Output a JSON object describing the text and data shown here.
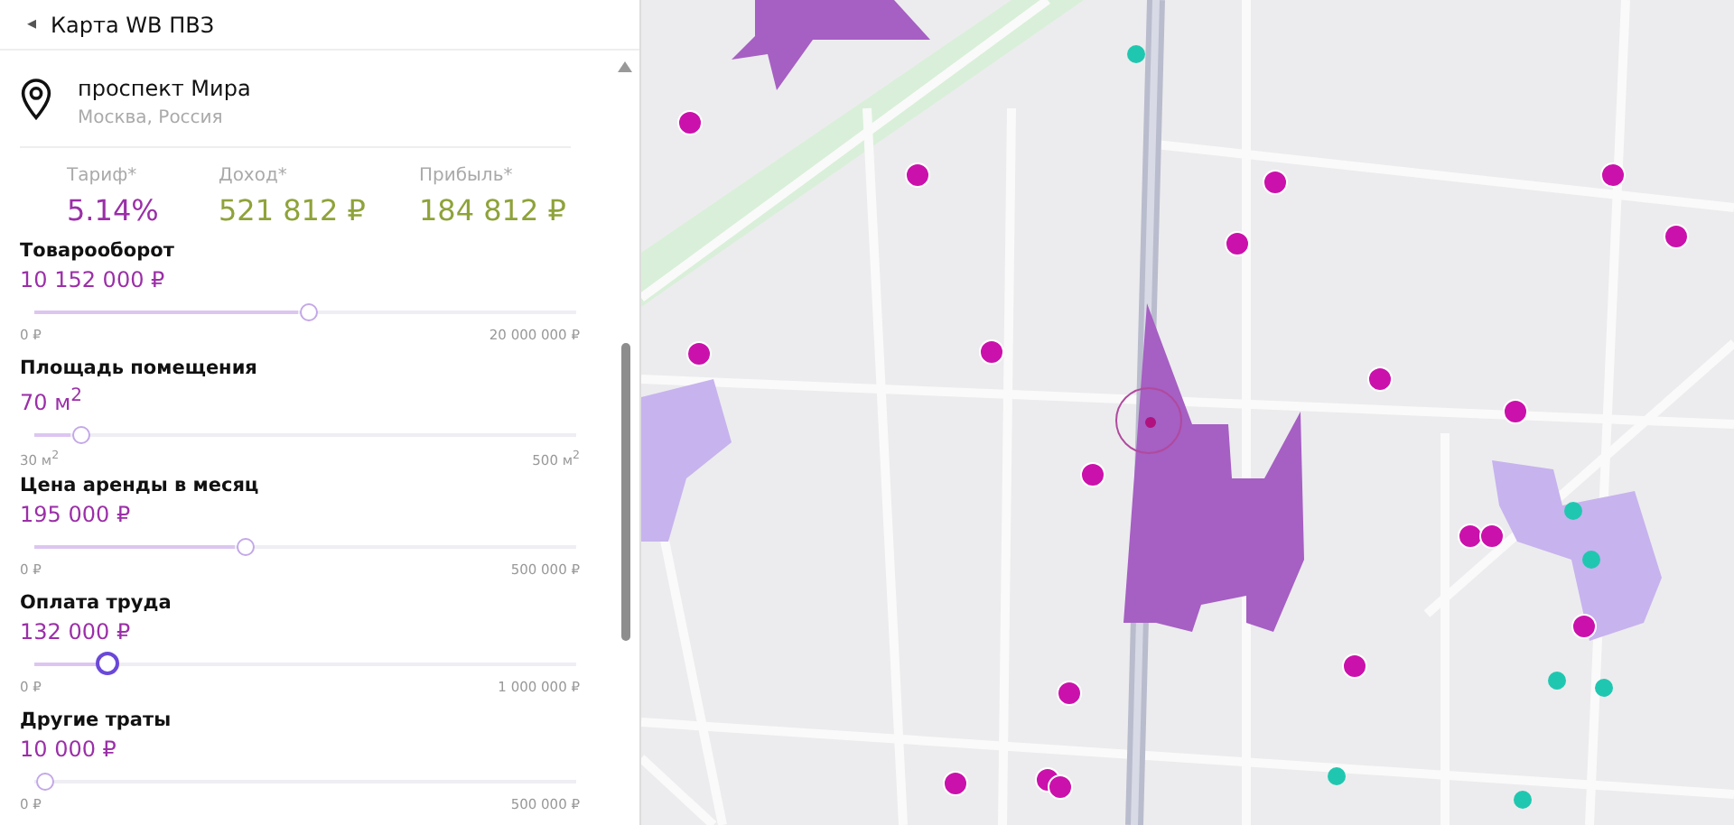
{
  "header": {
    "back_icon": "◂",
    "title": "Карта WB ПВЗ"
  },
  "location": {
    "name": "проспект Мира",
    "region": "Москва, Россия"
  },
  "stats": [
    {
      "label": "Тариф*",
      "value": "5.14%",
      "kind": "rate"
    },
    {
      "label": "Доход*",
      "value": "521 812 ₽",
      "kind": "money"
    },
    {
      "label": "Прибыль*",
      "value": "184 812 ₽",
      "kind": "money"
    }
  ],
  "sliders": [
    {
      "title": "Товарооборот",
      "value": "10 152 000 ₽",
      "level": 0.508,
      "focused": false,
      "min": "0 ₽",
      "max": "20 000 000 ₽"
    },
    {
      "title": "Площадь помещения",
      "value": "70 м$^{2}$",
      "level": 0.085,
      "focused": false,
      "min": "30 м$^{2}$",
      "max": "500 м$^{2}$"
    },
    {
      "title": "Цена аренды в месяц",
      "value": "195 000 ₽",
      "level": 0.39,
      "focused": false,
      "min": "0 ₽",
      "max": "500 000 ₽"
    },
    {
      "title": "Оплата труда",
      "value": "132 000 ₽",
      "level": 0.132,
      "focused": true,
      "min": "0 ₽",
      "max": "1 000 000 ₽"
    },
    {
      "title": "Другие траты",
      "value": "10 000 ₽",
      "level": 0.02,
      "focused": false,
      "min": "0 ₽",
      "max": "500 000 ₽"
    }
  ]
}
